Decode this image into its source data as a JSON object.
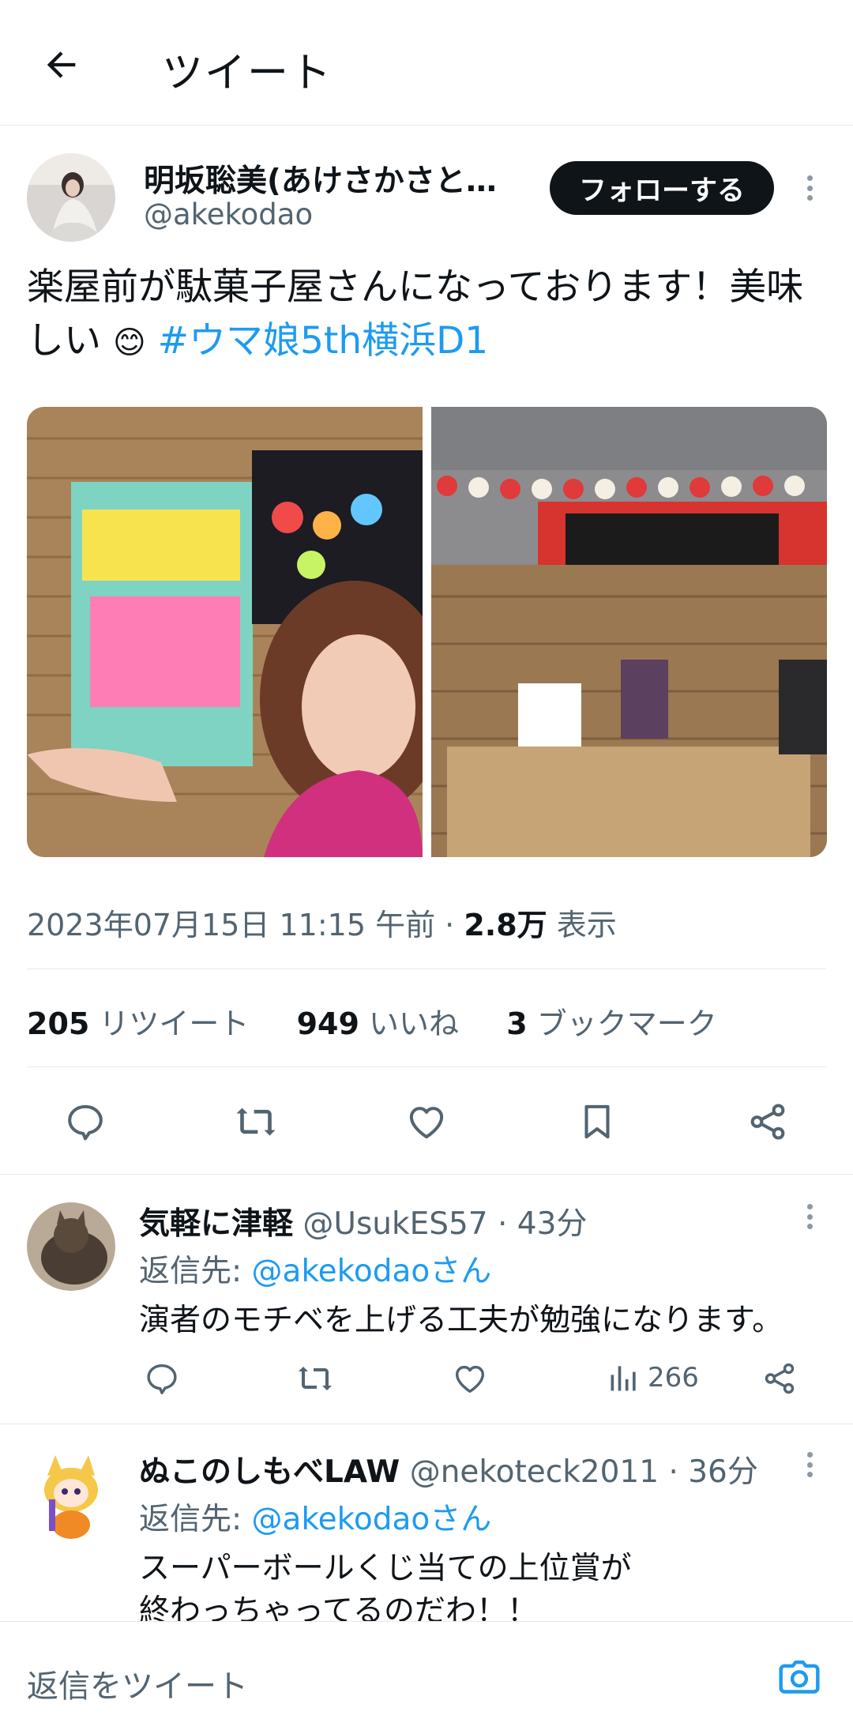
{
  "header": {
    "title": "ツイート",
    "back_icon": "arrow-left-icon"
  },
  "tweet": {
    "author_name": "明坂聡美(あけさかさと…",
    "author_handle": "@akekodao",
    "follow_label": "フォローする",
    "text": "楽屋前が駄菓子屋さんになっております！美味しい",
    "emoji": "😊",
    "hashtag": "#ウマ娘5th横浜D1",
    "meta_date": "2023年07月15日 11:15 午前 · ",
    "meta_views_count": "2.8万",
    "meta_views_label": " 表示",
    "stats": {
      "retweets_count": "205",
      "retweets_label": " リツイート",
      "likes_count": "949",
      "likes_label": " いいね",
      "bookmarks_count": "3",
      "bookmarks_label": " ブックマーク"
    }
  },
  "replies": [
    {
      "name": "気軽に津軽",
      "handle_time": "@UsukES57 · 43分",
      "reply_prefix": "返信先: ",
      "reply_link": "@akekodaoさん",
      "text_lines": [
        "演者のモチベを上げる工夫が勉強になります。"
      ],
      "views": "266"
    },
    {
      "name": "ぬこのしもべLAW",
      "handle_time": "@nekoteck2011 · 36分",
      "reply_prefix": "返信先: ",
      "reply_link": "@akekodaoさん",
      "text_lines": [
        "スーパーボールくじ当ての上位賞が",
        "終わっちゃってるのだわ！！"
      ]
    }
  ],
  "composer": {
    "placeholder": "返信をツイート",
    "camera_icon": "camera-icon"
  },
  "colors": {
    "accent": "#1d9bf0",
    "text": "#0f1419",
    "muted": "#536471",
    "divider": "#e6e9ec"
  }
}
